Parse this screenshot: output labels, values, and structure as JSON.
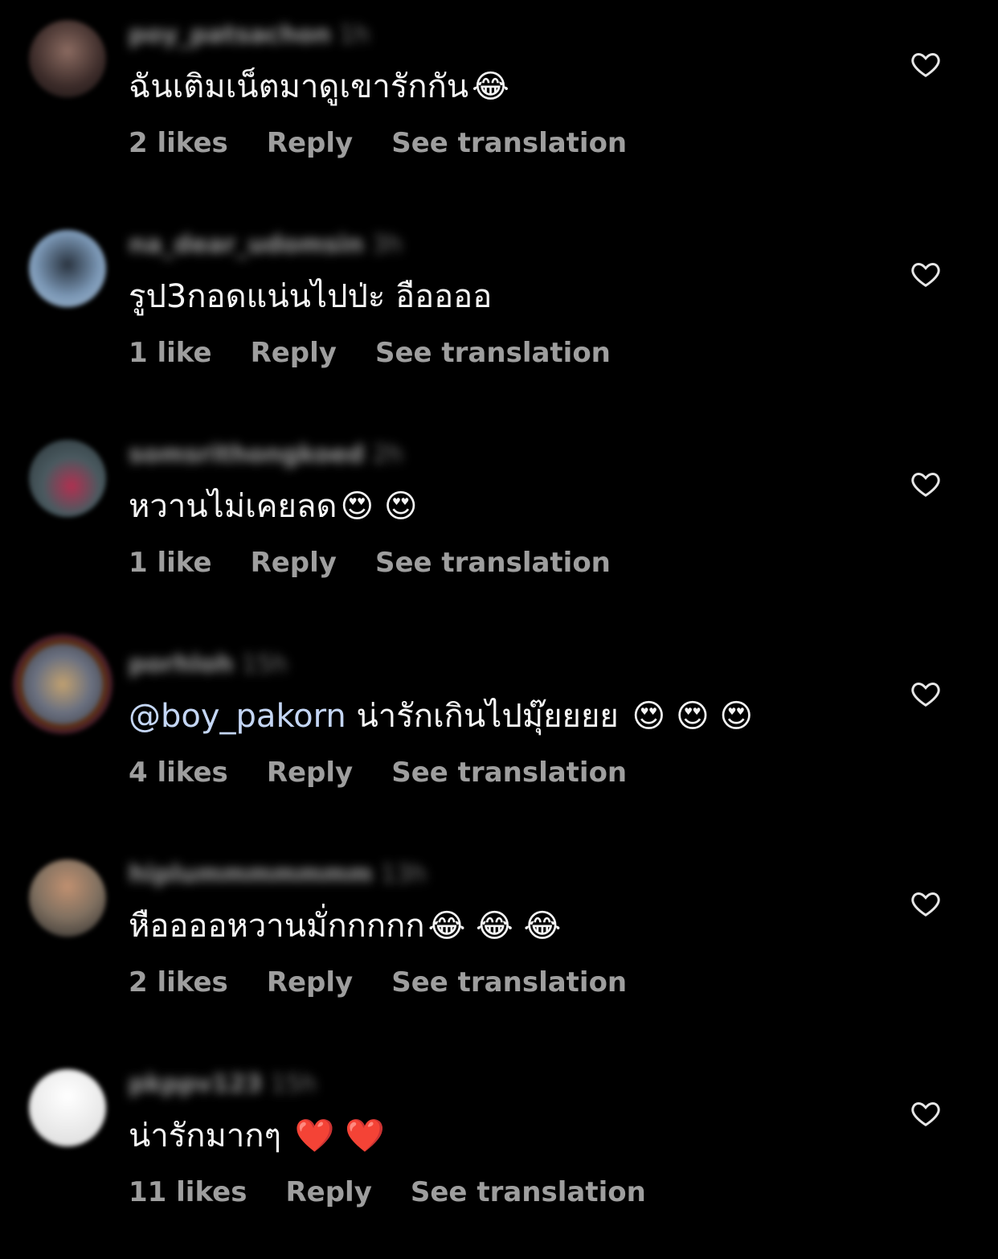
{
  "comments": [
    {
      "username": "poy_patsachon",
      "time": "1h",
      "text": "ฉันเติมเน็ตมาดูเขารักกัน",
      "emoji": "😂",
      "likes": "2 likes",
      "reply": "Reply",
      "translate": "See translation",
      "avatar_color": "#4a3a38"
    },
    {
      "username": "na_dear_udomsin",
      "time": "3h",
      "text": "รูป3กอดแน่นไปป่ะ อืออออ",
      "emoji": "",
      "likes": "1 like",
      "reply": "Reply",
      "translate": "See translation",
      "avatar_color": "#6f8aa6"
    },
    {
      "username": "somsrithongkoed",
      "time": "2h",
      "text": "หวานไม่เคยลด",
      "emoji": "😍 😍",
      "likes": "1 like",
      "reply": "Reply",
      "translate": "See translation",
      "avatar_color": "#5a6a70"
    },
    {
      "username": "porhloh",
      "time": "15h",
      "mention": "@boy_pakorn",
      "text": " น่ารักเกินไปมุ๊ยยยย ",
      "emoji": "😍 😍 😍",
      "likes": "4 likes",
      "reply": "Reply",
      "translate": "See translation",
      "avatar_color": "#8a7a60"
    },
    {
      "username": "hiplummmmmmm",
      "time": "13h",
      "text": "หืออออหวานมั่กกกกก",
      "emoji": "😂 😂 😂",
      "likes": "2 likes",
      "reply": "Reply",
      "translate": "See translation",
      "avatar_color": "#9a8a80"
    },
    {
      "username": "pkppv123",
      "time": "15h",
      "text": "น่ารักมากๆ ",
      "emoji": "❤️ ❤️",
      "likes": "11 likes",
      "reply": "Reply",
      "translate": "See translation",
      "avatar_color": "#e8e8e8"
    }
  ]
}
